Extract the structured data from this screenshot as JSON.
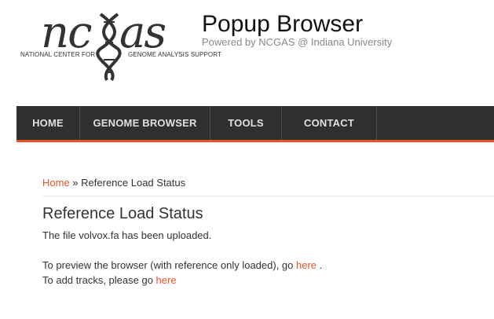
{
  "header": {
    "logo_word": "ncgas",
    "logo_sub_left": "NATIONAL CENTER FOR",
    "logo_sub_right": "GENOME ANALYSIS SUPPORT",
    "site_title": "Popup Browser",
    "tagline": "Powered by NCGAS @ Indiana University"
  },
  "nav": {
    "items": [
      {
        "label": "HOME"
      },
      {
        "label": "GENOME BROWSER"
      },
      {
        "label": "TOOLS"
      },
      {
        "label": "CONTACT"
      }
    ]
  },
  "breadcrumb": {
    "home": "Home",
    "separator": " » ",
    "current": "Reference Load Status"
  },
  "main": {
    "title": "Reference Load Status",
    "upload_message": "The file volvox.fa has been uploaded.",
    "preview_prefix": "To preview the browser (with reference only loaded), go ",
    "preview_link": "here",
    "preview_suffix": " .",
    "tracks_prefix": "To add tracks, please go ",
    "tracks_link": "here"
  },
  "colors": {
    "accent": "#e8542a",
    "nav_bg": "#2f2f2f"
  }
}
